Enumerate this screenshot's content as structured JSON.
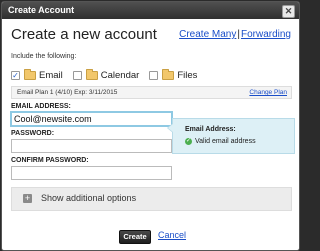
{
  "window": {
    "title": "Create Account",
    "close_glyph": "✕"
  },
  "heading": "Create a new account",
  "links": {
    "create_many": "Create Many",
    "separator": "|",
    "forwarding": "Forwarding"
  },
  "include_label": "Include the following:",
  "services": [
    {
      "label": "Email",
      "checked": true,
      "icon": "folder-icon"
    },
    {
      "label": "Calendar",
      "checked": false,
      "icon": "folder-icon"
    },
    {
      "label": "Files",
      "checked": false,
      "icon": "folder-icon"
    }
  ],
  "plan": {
    "text": "Email Plan 1 (4/10)  Exp: 3/11/2015",
    "change_label": "Change Plan"
  },
  "fields": {
    "email_label": "EMAIL ADDRESS:",
    "email_value": "Cool@newsite.com",
    "password_label": "PASSWORD:",
    "password_value": "",
    "confirm_label": "CONFIRM PASSWORD:",
    "confirm_value": ""
  },
  "tooltip": {
    "title": "Email Address:",
    "message": "Valid email address",
    "icon": "check-icon"
  },
  "options": {
    "label": "Show additional options",
    "icon": "plus-icon"
  },
  "actions": {
    "create_label": "Create",
    "cancel_label": "Cancel"
  },
  "colors": {
    "link": "#1a4ec8",
    "tooltip_bg": "#ddf0f6",
    "input_focus": "#8ec9e3",
    "valid": "#4caf50"
  }
}
